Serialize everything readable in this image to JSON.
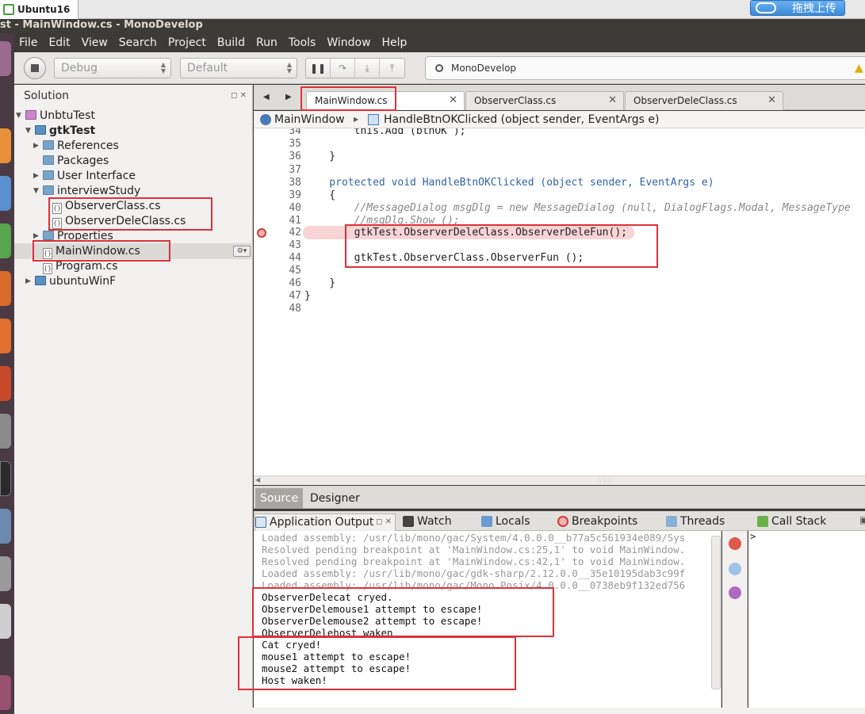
{
  "vm": {
    "tab_title": "Ubuntu16",
    "upload_label": "拖拽上传"
  },
  "window": {
    "title": "st - MainWindow.cs - MonoDevelop"
  },
  "menu": [
    "File",
    "Edit",
    "View",
    "Search",
    "Project",
    "Build",
    "Run",
    "Tools",
    "Window",
    "Help"
  ],
  "toolbar": {
    "config": "Debug",
    "platform": "Default",
    "status": "MonoDevelop"
  },
  "solution": {
    "header": "Solution",
    "tree": [
      {
        "label": "UnbtuTest",
        "icon": "solution-icon",
        "bold": false
      },
      {
        "label": "gtkTest",
        "icon": "project-icon",
        "bold": true
      },
      {
        "label": "References",
        "icon": "folder-icon"
      },
      {
        "label": "Packages",
        "icon": "folder-icon"
      },
      {
        "label": "User Interface",
        "icon": "folder-icon"
      },
      {
        "label": "interviewStudy",
        "icon": "folder-icon"
      },
      {
        "label": "ObserverClass.cs",
        "icon": "file-icon"
      },
      {
        "label": "ObserverDeleClass.cs",
        "icon": "file-icon"
      },
      {
        "label": "Properties",
        "icon": "folder-icon"
      },
      {
        "label": "MainWindow.cs",
        "icon": "file-icon"
      },
      {
        "label": "Program.cs",
        "icon": "file-icon"
      },
      {
        "label": "ubuntuWinF",
        "icon": "project-icon",
        "bold": true
      }
    ]
  },
  "editor": {
    "tabs": [
      "MainWindow.cs",
      "ObserverClass.cs",
      "ObserverDeleClass.cs"
    ],
    "breadcrumb": {
      "class": "MainWindow",
      "method": "HandleBtnOKClicked (object sender, EventArgs e)"
    },
    "lines": [
      {
        "n": "34",
        "code": "        this.Add (btnOK );"
      },
      {
        "n": "35",
        "code": ""
      },
      {
        "n": "36",
        "code": "    }"
      },
      {
        "n": "37",
        "code": ""
      },
      {
        "n": "38",
        "code": "    protected void HandleBtnOKClicked (object sender, EventArgs e)"
      },
      {
        "n": "39",
        "code": "    {"
      },
      {
        "n": "40",
        "code": "        //MessageDialog msgDlg = new MessageDialog (null, DialogFlags.Modal, MessageType"
      },
      {
        "n": "41",
        "code": "        //msgDlg.Show ();"
      },
      {
        "n": "42",
        "code": "        gtkTest.ObserverDeleClass.ObserverDeleFun();"
      },
      {
        "n": "43",
        "code": ""
      },
      {
        "n": "44",
        "code": "        gtkTest.ObserverClass.ObserverFun ();"
      },
      {
        "n": "45",
        "code": ""
      },
      {
        "n": "46",
        "code": "    }"
      },
      {
        "n": "47",
        "code": "}"
      },
      {
        "n": "48",
        "code": ""
      }
    ]
  },
  "views": {
    "source": "Source",
    "designer": "Designer"
  },
  "pads": [
    "Application Output",
    "Watch",
    "Locals",
    "Breakpoints",
    "Threads",
    "Call Stack"
  ],
  "output": {
    "log": [
      "Loaded assembly: /usr/lib/mono/gac/System/4.0.0.0__b77a5c561934e089/Sys",
      "Resolved pending breakpoint at 'MainWindow.cs:25,1' to void MainWindow.",
      "Resolved pending breakpoint at 'MainWindow.cs:42,1' to void MainWindow.",
      "Loaded assembly: /usr/lib/mono/gac/gdk-sharp/2.12.0.0__35e10195dab3c99f",
      "Loaded assembly: /usr/lib/mono/gac/Mono.Posix/4.0.0.0__0738eb9f132ed756"
    ],
    "program": [
      "ObserverDelecat cryed.",
      "ObserverDelemouse1 attempt to escape!",
      "ObserverDelemouse2 attempt to escape!",
      "ObserverDelehost waken",
      "Cat cryed!",
      "mouse1 attempt to escape!",
      "mouse2 attempt to escape!",
      "Host waken!"
    ]
  },
  "callstack": {
    "prompt": ">"
  }
}
